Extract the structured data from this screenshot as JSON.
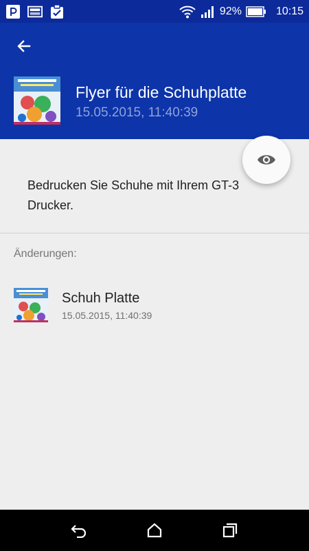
{
  "status_bar": {
    "battery_percent": "92%",
    "time": "10:15",
    "left_icons": [
      "app-notification-icon",
      "image-notification-icon",
      "clipboard-check-icon"
    ],
    "right_icons": [
      "wifi-icon",
      "signal-icon",
      "battery-icon"
    ]
  },
  "header": {
    "title": "Flyer für die Schuhplatte",
    "subtitle": "15.05.2015, 11:40:39",
    "background_color": "#0d34a8",
    "back_icon": "arrow-left-icon",
    "fab_icon": "eye-icon"
  },
  "description": "Bedrucken Sie Schuhe mit Ihrem GT-3 Drucker.",
  "changes": {
    "label": "Änderungen:",
    "items": [
      {
        "title": "Schuh Platte",
        "subtitle": "15.05.2015, 11:40:39"
      }
    ]
  },
  "nav_bar": {
    "icons": [
      "back-nav-icon",
      "home-icon",
      "recents-icon"
    ]
  }
}
